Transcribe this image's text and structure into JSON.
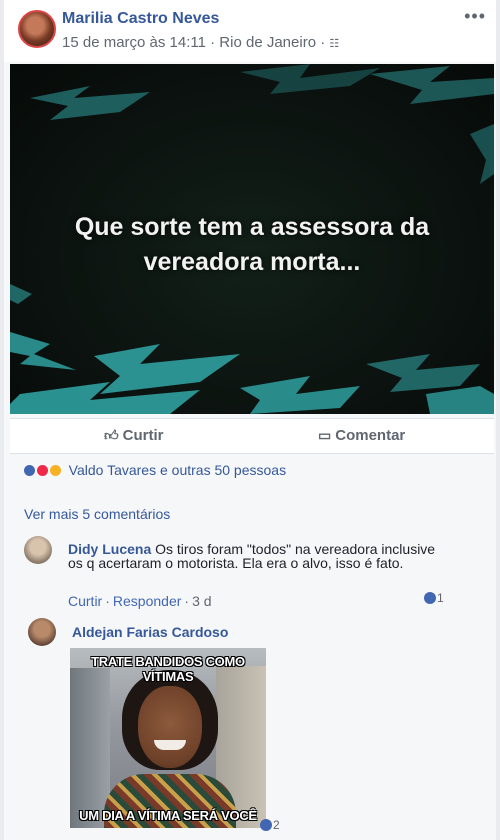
{
  "post": {
    "author": "Marilia Castro Neves",
    "meta": "15 de março às 14:11 · Rio de Janeiro ·",
    "audience_icon": "friends-icon",
    "more_icon": "•••",
    "image_caption_line1": "Que sorte tem a assessora da",
    "image_caption_line2": "vereadora morta...",
    "image_colors": {
      "background": "#0b120f",
      "bolt": "#2fa0a0"
    }
  },
  "actions": {
    "like_label": "Curtir",
    "comment_label": "Comentar"
  },
  "reactions": {
    "summary": "Valdo Tavares e outras 50 pessoas",
    "types": [
      "like",
      "love",
      "haha"
    ]
  },
  "comments_section": {
    "more_comments": "Ver mais 5 comentários",
    "comments": [
      {
        "author": "Didy Lucena",
        "text": "Os tiros foram \"todos\" na vereadora inclusive os q acertaram o motorista. Ela era o alvo, isso é fato.",
        "like_action": "Curtir",
        "reply_action": "Responder",
        "age": "3 d",
        "like_count": "1"
      },
      {
        "author": "Aldejan Farias Cardoso",
        "meme_top": "TRATE BANDIDOS COMO VÍTIMAS",
        "meme_bottom": "UM DIA A VÍTIMA SERÁ VOCÊ",
        "like_count": "2"
      }
    ]
  }
}
